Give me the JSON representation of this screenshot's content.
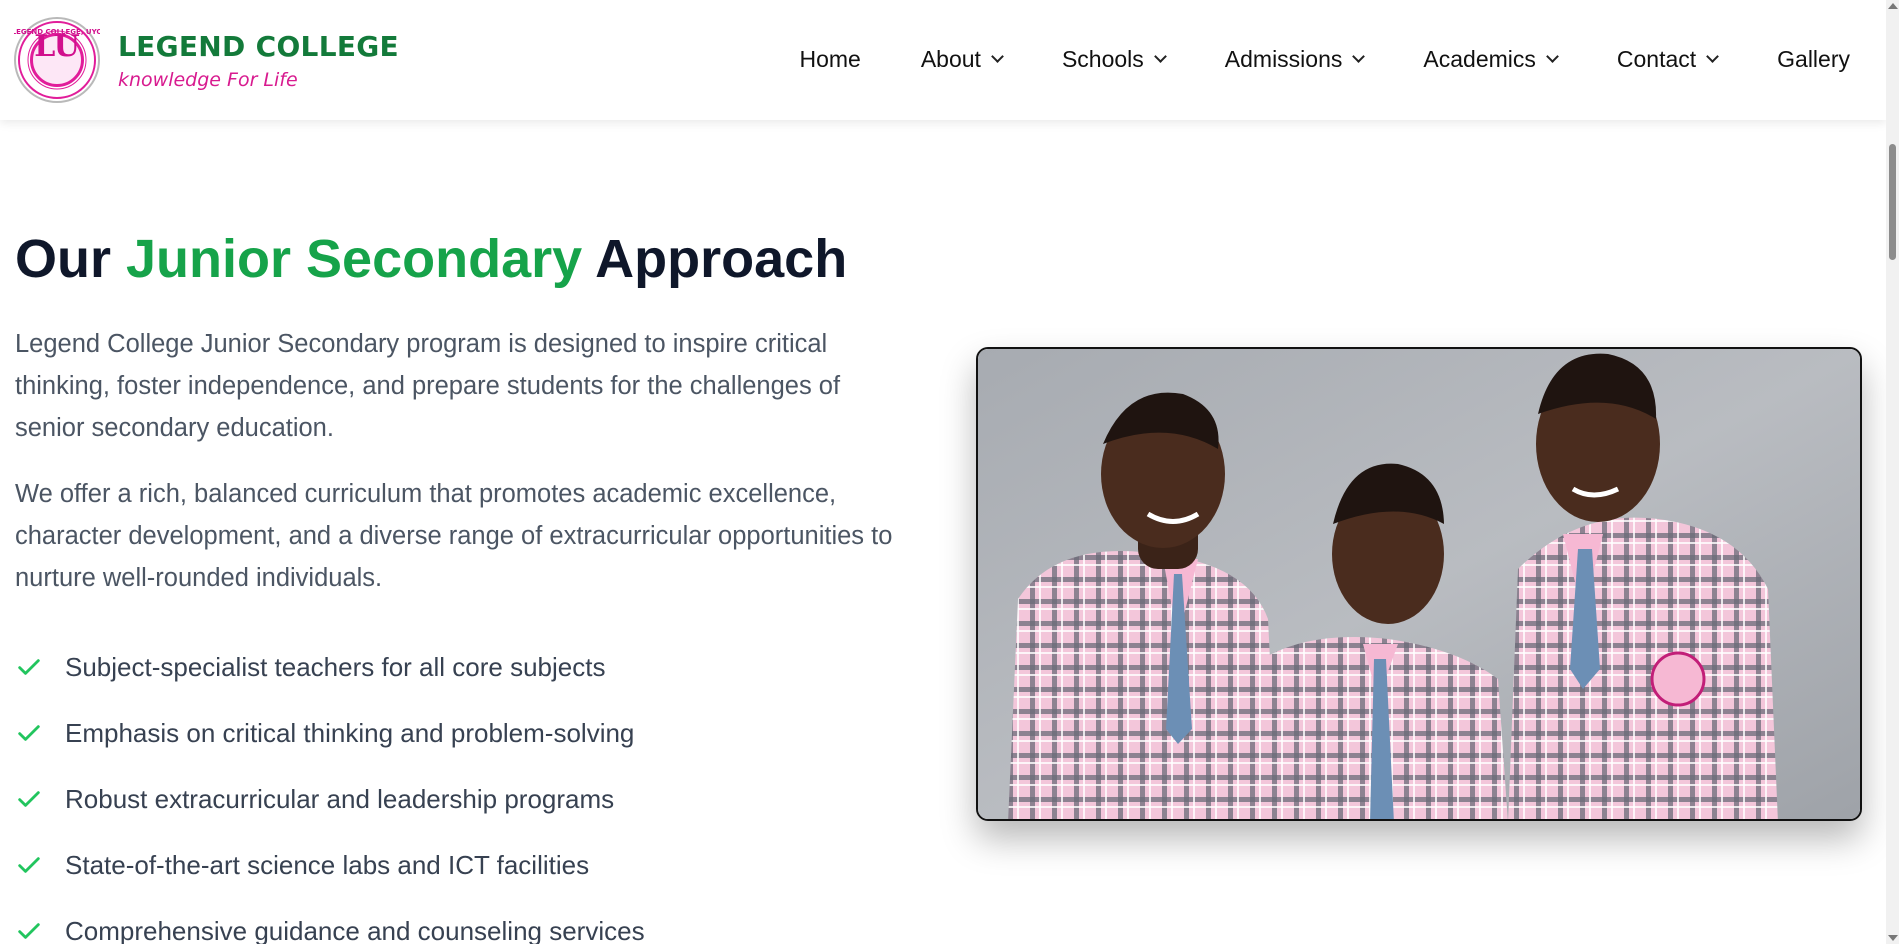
{
  "brand": {
    "name": "LEGEND COLLEGE",
    "tagline": "knowledge For Life",
    "seal_letters": "LU",
    "seal_text": "LEGEND COLLEGE, UYO"
  },
  "nav": {
    "items": [
      {
        "label": "Home",
        "dropdown": false
      },
      {
        "label": "About",
        "dropdown": true
      },
      {
        "label": "Schools",
        "dropdown": true
      },
      {
        "label": "Admissions",
        "dropdown": true
      },
      {
        "label": "Academics",
        "dropdown": true
      },
      {
        "label": "Contact",
        "dropdown": true
      },
      {
        "label": "Gallery",
        "dropdown": false
      }
    ]
  },
  "section": {
    "title_part1": "Our ",
    "title_highlight": "Junior Secondary",
    "title_part2": " Approach",
    "paragraph1": "Legend College Junior Secondary program is designed to inspire critical thinking, foster independence, and prepare students for the challenges of senior secondary education.",
    "paragraph2": "We offer a rich, balanced curriculum that promotes academic excellence, character development, and a diverse range of extracurricular opportunities to nurture well-rounded individuals.",
    "features": [
      "Subject-specialist teachers for all core subjects",
      "Emphasis on critical thinking and problem-solving",
      "Robust extracurricular and leadership programs",
      "State-of-the-art science labs and ICT facilities",
      "Comprehensive guidance and counseling services"
    ]
  },
  "icons": {
    "feature_bullet": "check-icon",
    "nav_dropdown": "chevron-down-icon"
  },
  "colors": {
    "brand_green": "#137a3a",
    "accent_green": "#16a34a",
    "brand_pink": "#d81b8f",
    "heading": "#0f172a",
    "body_text": "#4b5563"
  }
}
